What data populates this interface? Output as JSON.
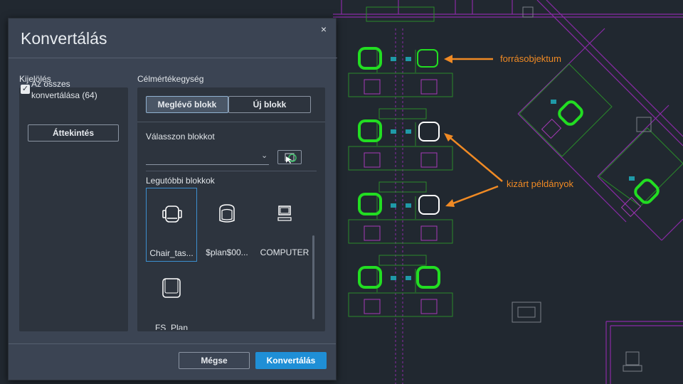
{
  "dialog": {
    "title": "Konvertálás",
    "close_label": "×",
    "selection": {
      "heading": "Kijelölés",
      "convert_all_label": "Az összes konvertálása (64)",
      "convert_all_checked": true,
      "preview_button": "Áttekintés"
    },
    "target": {
      "heading": "Célmértékegység",
      "tabs": [
        "Meglévő blokk",
        "Új blokk"
      ],
      "active_tab": "Meglévő blokk",
      "choose_block_label": "Válasszon blokkot",
      "choose_block_value": "",
      "recent_heading": "Legutóbbi blokkok",
      "recent_blocks": [
        {
          "label": "Chair_tas...",
          "icon": "task-chair-icon",
          "selected": true
        },
        {
          "label": "$plan$00...",
          "icon": "armchair-icon",
          "selected": false
        },
        {
          "label": "COMPUTER",
          "icon": "computer-icon",
          "selected": false
        },
        {
          "label": "FS_Plan",
          "icon": "lounge-chair-icon",
          "selected": false
        }
      ]
    },
    "cancel_button": "Mégse",
    "convert_button": "Konvertálás"
  },
  "annotations": {
    "source": "forrásobjektum",
    "excluded": "kizárt példányok"
  },
  "colors": {
    "background": "#212830",
    "dialog": "#3b4453",
    "panel": "#2d343e",
    "accent": "#1f8fd6",
    "highlight_green": "#22dd22",
    "annotation_orange": "#f08a24",
    "cad_purple": "#8a2aa6"
  }
}
